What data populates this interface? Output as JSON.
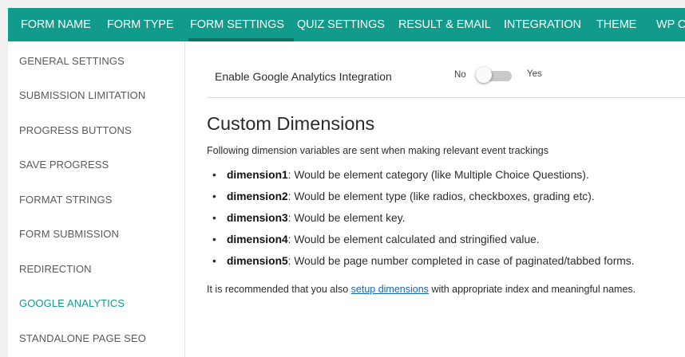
{
  "tabs": [
    {
      "label": "FORM NAME"
    },
    {
      "label": "FORM TYPE"
    },
    {
      "label": "FORM SETTINGS",
      "active": true
    },
    {
      "label": "QUIZ SETTINGS"
    },
    {
      "label": "RESULT & EMAIL"
    },
    {
      "label": "INTEGRATION"
    },
    {
      "label": "THEME"
    },
    {
      "label": "WP CO"
    }
  ],
  "sidebar": {
    "items": [
      {
        "label": "GENERAL SETTINGS"
      },
      {
        "label": "SUBMISSION LIMITATION"
      },
      {
        "label": "PROGRESS BUTTONS"
      },
      {
        "label": "SAVE PROGRESS"
      },
      {
        "label": "FORMAT STRINGS"
      },
      {
        "label": "FORM SUBMISSION"
      },
      {
        "label": "REDIRECTION"
      },
      {
        "label": "GOOGLE ANALYTICS",
        "active": true
      },
      {
        "label": "STANDALONE PAGE SEO"
      }
    ]
  },
  "analytics": {
    "label": "Enable Google Analytics Integration",
    "no": "No",
    "yes": "Yes",
    "enabled": false
  },
  "content": {
    "heading": "Custom Dimensions",
    "intro": "Following dimension variables are sent when making relevant event trackings",
    "dimensions": [
      {
        "name": "dimension1",
        "desc": ": Would be element category (like Multiple Choice Questions)."
      },
      {
        "name": "dimension2",
        "desc": ": Would be element type (like radios, checkboxes, grading etc)."
      },
      {
        "name": "dimension3",
        "desc": ": Would be element key."
      },
      {
        "name": "dimension4",
        "desc": ": Would be element calculated and stringified value."
      },
      {
        "name": "dimension5",
        "desc": ": Would be page number completed in case of paginated/tabbed forms."
      }
    ],
    "note": {
      "before": "It is recommended that you also ",
      "link": "setup dimensions",
      "after": " with appropriate index and meaningful names."
    }
  },
  "colors": {
    "accent": "#119b8a",
    "link": "#1a64b8"
  }
}
